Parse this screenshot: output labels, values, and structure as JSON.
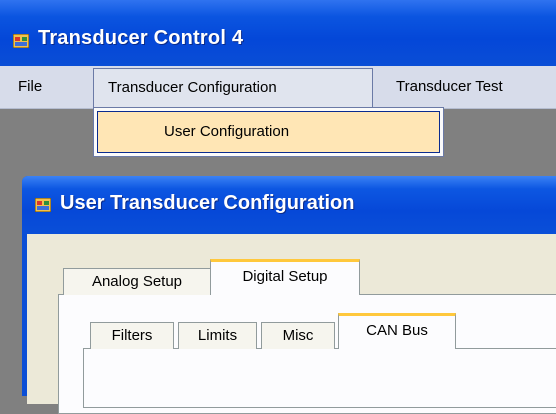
{
  "app": {
    "title": "Transducer Control 4"
  },
  "menubar": {
    "items": [
      {
        "label": "File"
      },
      {
        "label": "Transducer Configuration"
      },
      {
        "label": "Transducer Test"
      }
    ]
  },
  "dropdown": {
    "items": [
      {
        "label": "User Configuration"
      }
    ]
  },
  "child_window": {
    "title": "User Transducer Configuration",
    "tabs": [
      {
        "label": "Analog Setup"
      },
      {
        "label": "Digital Setup"
      }
    ],
    "subtabs": [
      {
        "label": "Filters"
      },
      {
        "label": "Limits"
      },
      {
        "label": "Misc"
      },
      {
        "label": "CAN Bus"
      }
    ]
  },
  "icons": {
    "app": "app-window-icon",
    "child": "app-window-icon"
  },
  "colors": {
    "titlebar": "#0447d8",
    "menubar": "#d7dcea",
    "highlight": "#ffe6b5",
    "tab_accent": "#ffc83c"
  }
}
